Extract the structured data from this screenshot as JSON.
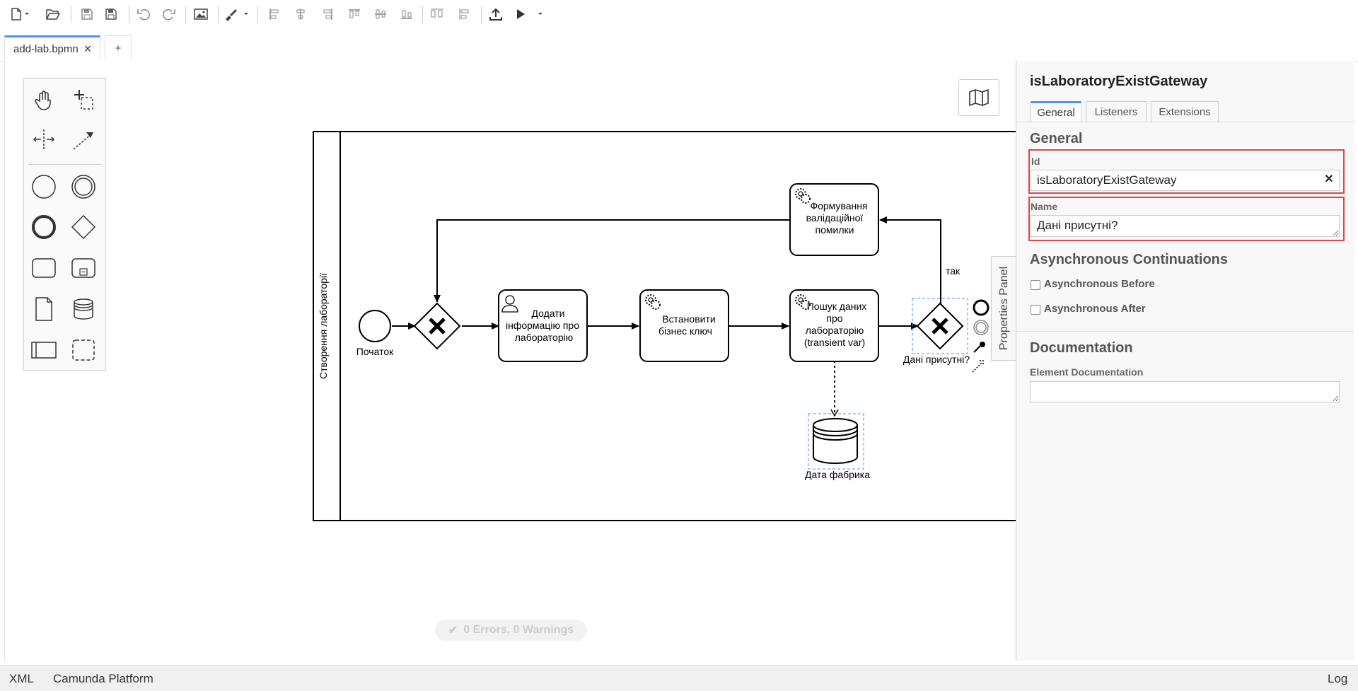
{
  "tabs": {
    "file": "add-lab.bpmn",
    "new_tab": "+"
  },
  "diagram": {
    "pool_label": "Створення лабораторії",
    "start_event": "Початок",
    "task_add_info": [
      "Додати",
      "інформацію про",
      "лабораторію"
    ],
    "task_business_key": [
      "Встановити",
      "бізнес ключ"
    ],
    "task_search": [
      "Пошук даних",
      "про",
      "лабораторію",
      "(transient var)"
    ],
    "task_validation_error": [
      "Формування",
      "валідаційної",
      "помилки"
    ],
    "gateway_label": "Дані присутні?",
    "flow_label_yes": "так",
    "data_store": "Дата фабрика"
  },
  "validation": {
    "text": "0 Errors, 0 Warnings"
  },
  "properties": {
    "toggle_label": "Properties Panel",
    "title": "isLaboratoryExistGateway",
    "tabs": [
      "General",
      "Listeners",
      "Extensions"
    ],
    "group_general": "General",
    "id_label": "Id",
    "id_value": "isLaboratoryExistGateway",
    "clear_icon": "×",
    "name_label": "Name",
    "name_value": "Дані присутні?",
    "group_async": "Asynchronous Continuations",
    "async_before": "Asynchronous Before",
    "async_after": "Asynchronous After",
    "group_doc": "Documentation",
    "doc_label": "Element Documentation",
    "doc_value": ""
  },
  "footer": {
    "xml": "XML",
    "platform": "Camunda Platform",
    "log": "Log"
  },
  "colors": {
    "accent": "#4d90ff",
    "highlight": "#e0474c",
    "selection": "#4d90ff"
  }
}
